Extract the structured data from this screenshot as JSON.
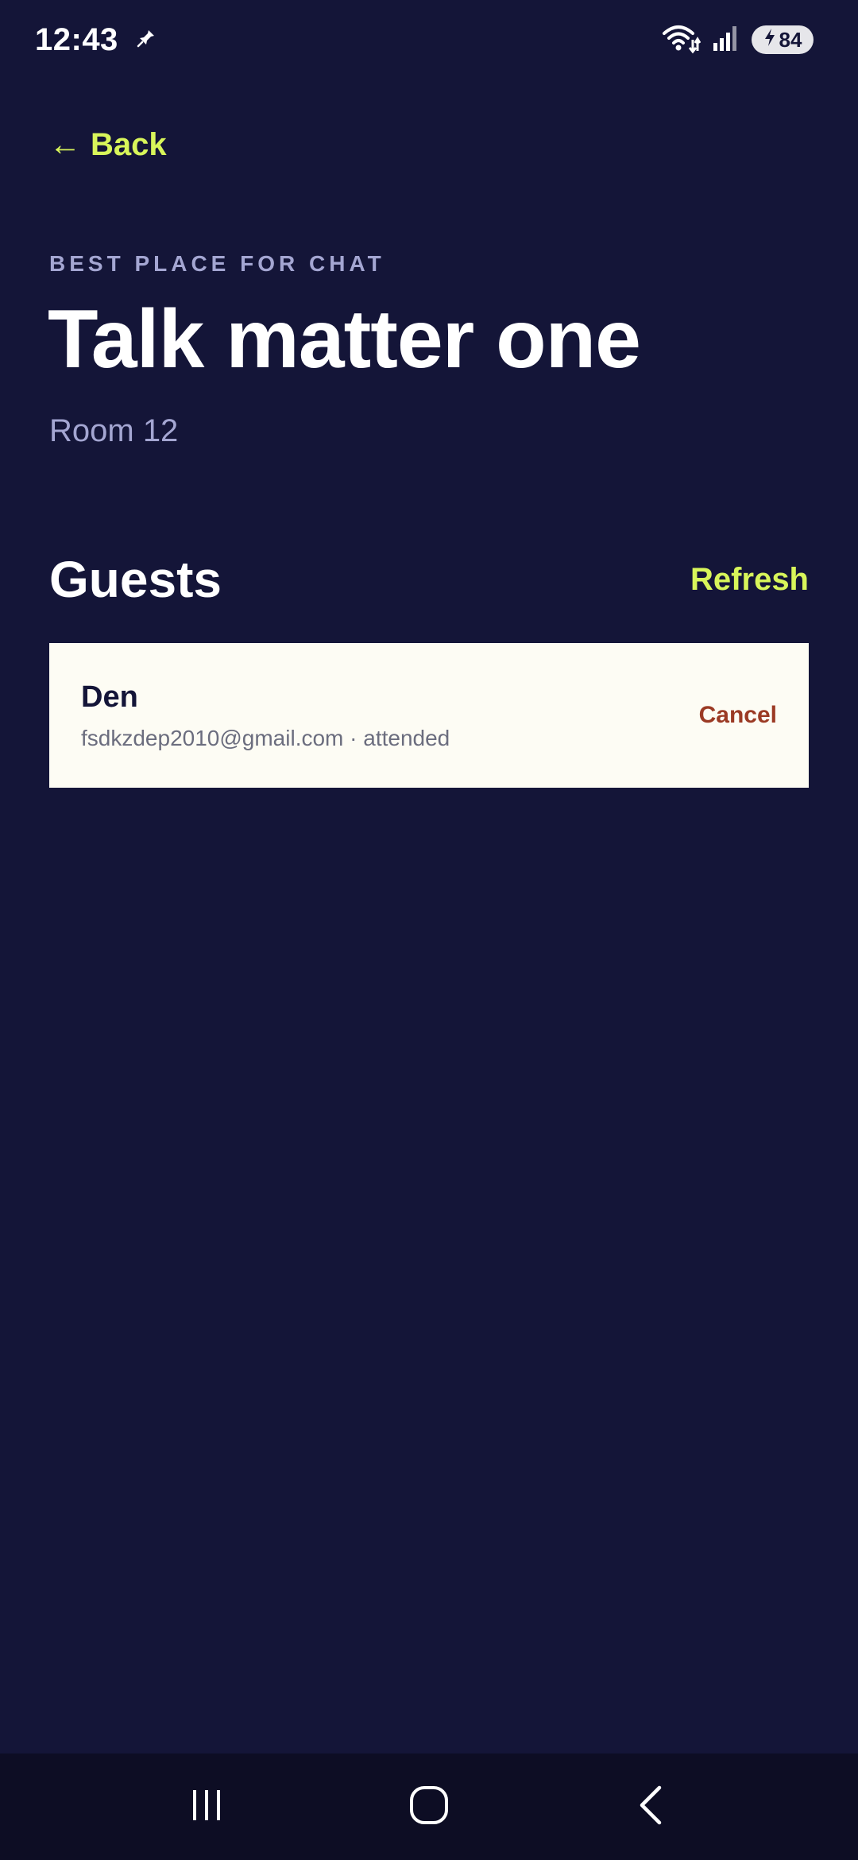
{
  "status_bar": {
    "time": "12:43",
    "battery_level": "84"
  },
  "nav": {
    "back_label": "Back",
    "back_arrow": "←"
  },
  "header": {
    "eyebrow": "BEST PLACE FOR CHAT",
    "title": "Talk matter one",
    "room": "Room 12"
  },
  "guests": {
    "title": "Guests",
    "refresh_label": "Refresh",
    "items": [
      {
        "name": "Den",
        "meta": "fsdkzdep2010@gmail.com · attended",
        "action_label": "Cancel"
      }
    ]
  },
  "colors": {
    "background": "#141538",
    "accent": "#d8f55a",
    "muted": "#a4a6d2",
    "card": "#fdfcf4",
    "danger": "#9b3a24"
  },
  "icons": {
    "status_left": "pin-icon",
    "wifi": "wifi-icon",
    "signal": "signal-icon",
    "battery": "battery-icon",
    "charging": "bolt-icon",
    "nav_recents": "recents-icon",
    "nav_home": "home-icon",
    "nav_back": "back-icon"
  }
}
